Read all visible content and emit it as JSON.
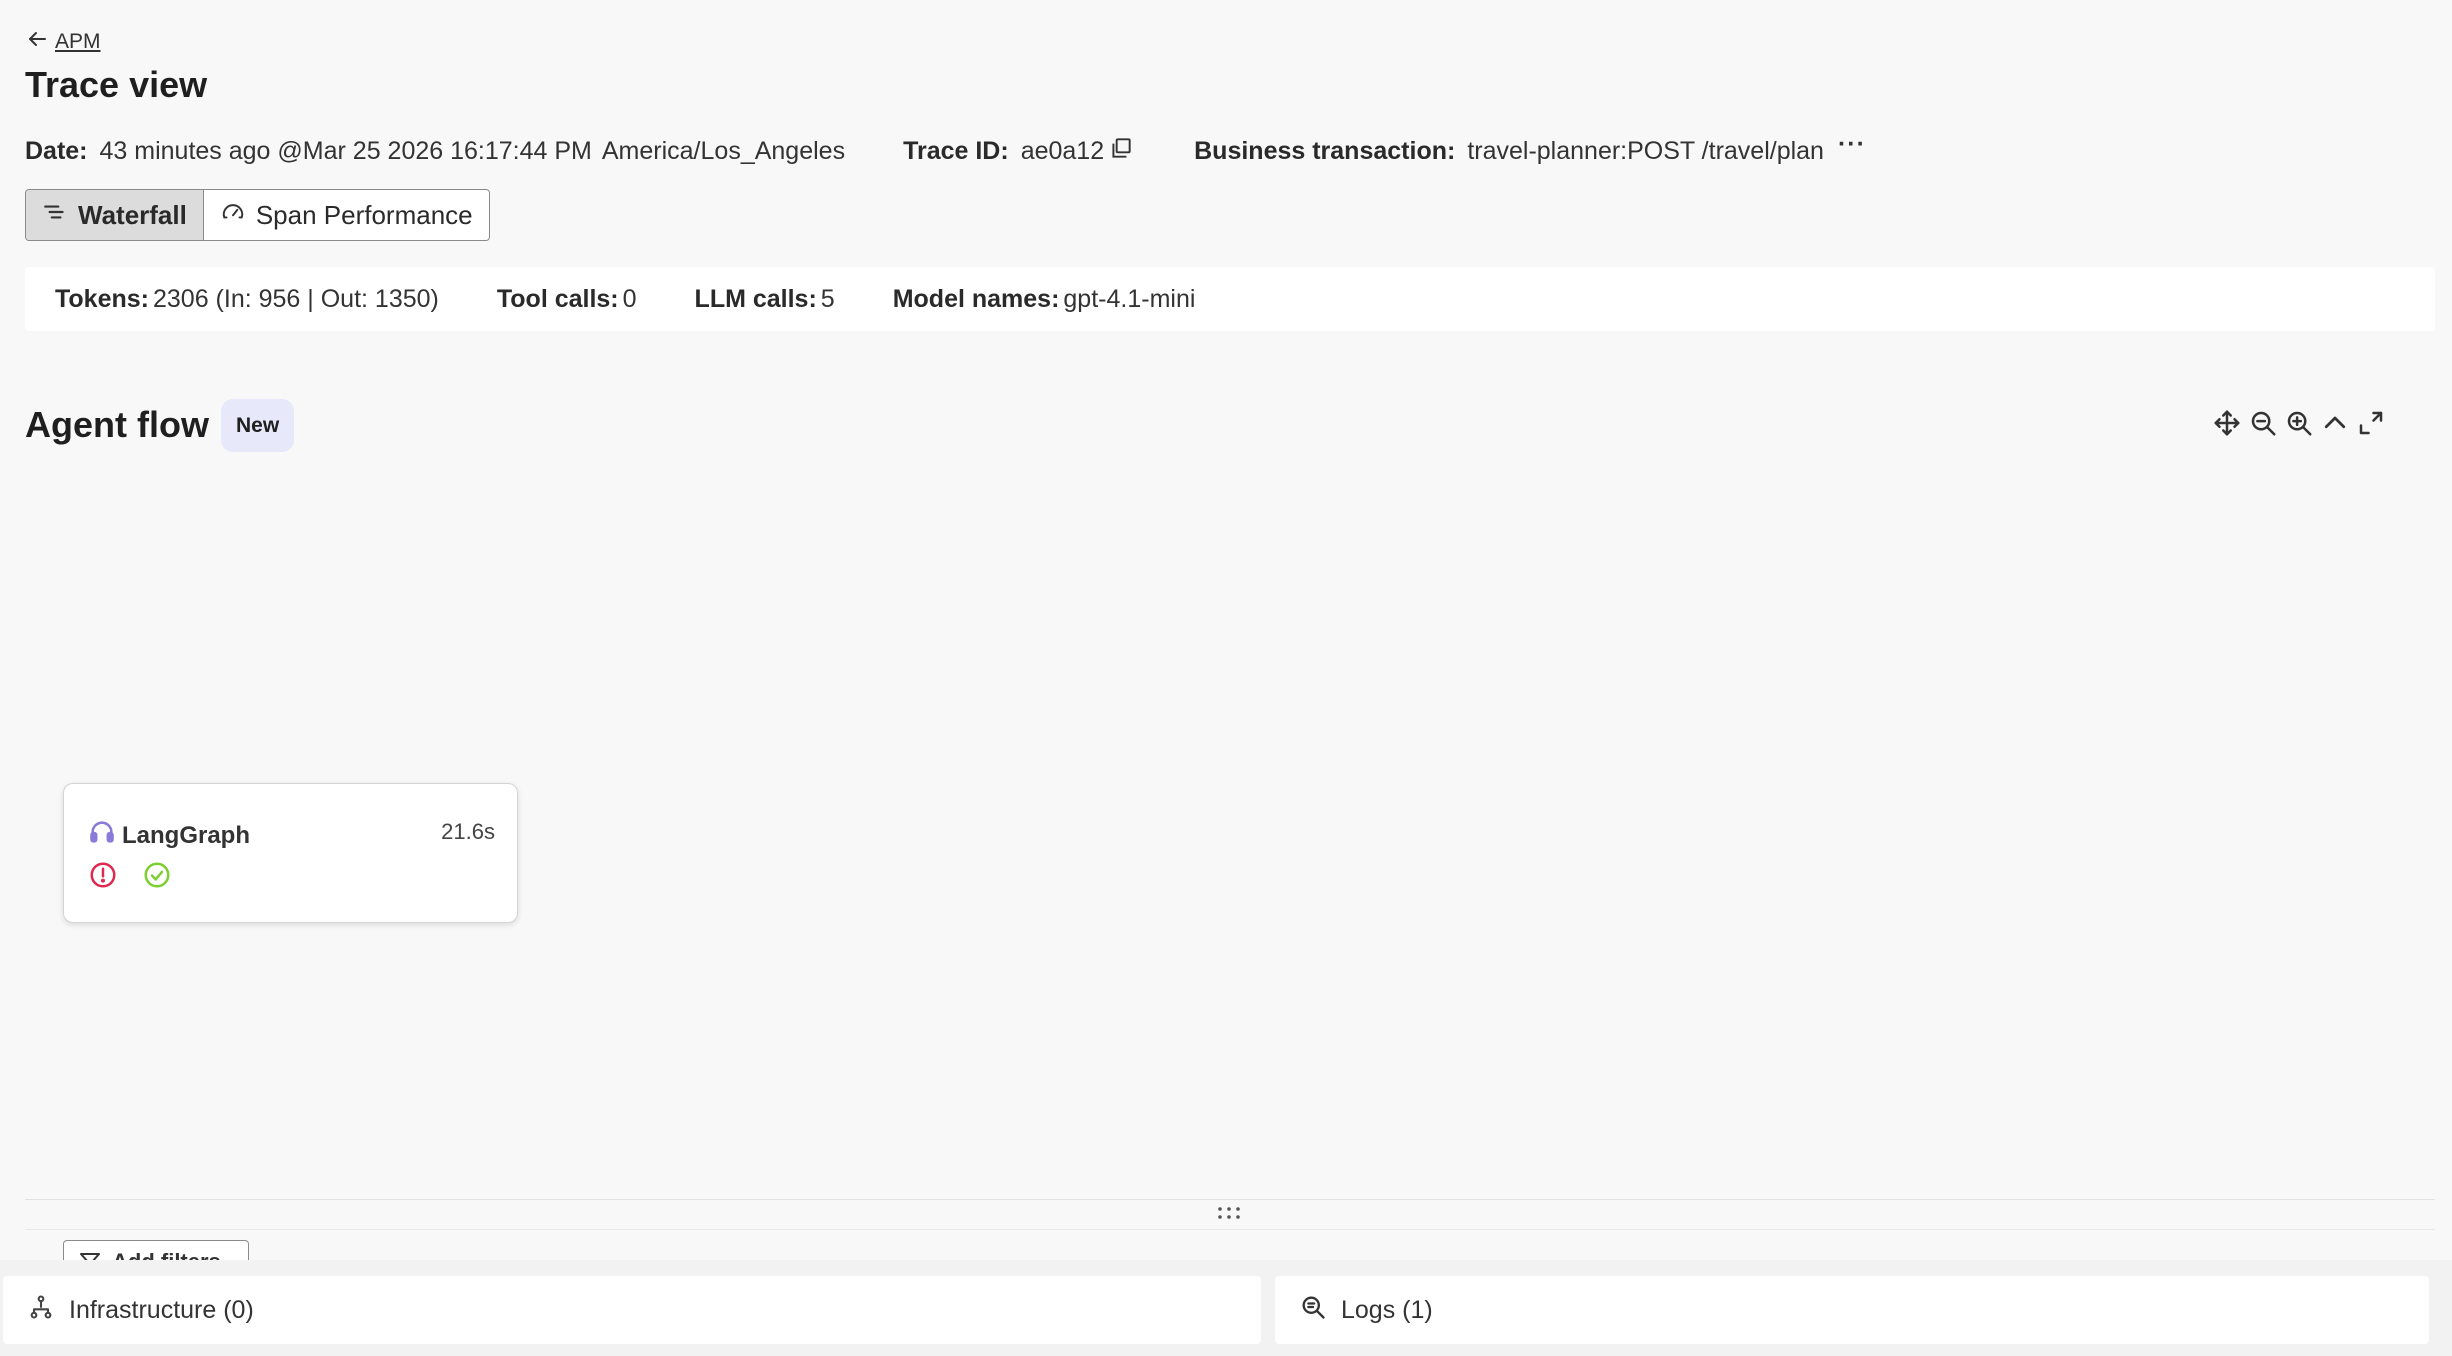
{
  "breadcrumb": {
    "label": "APM"
  },
  "page": {
    "title": "Trace view"
  },
  "meta": {
    "date_label": "Date:",
    "date_value": "43 minutes ago @Mar 25 2026 16:17:44 PM",
    "timezone": "America/Los_Angeles",
    "trace_label": "Trace ID:",
    "trace_value": "ae0a12",
    "bt_label": "Business transaction:",
    "bt_value": "travel-planner:POST /travel/plan",
    "more": "···"
  },
  "view_toggle": {
    "options": [
      {
        "label": "Waterfall",
        "icon": "waterfall-icon",
        "active": true
      },
      {
        "label": "Span Performance",
        "icon": "gauge-icon",
        "active": false
      }
    ]
  },
  "stats": {
    "tokens_label": "Tokens:",
    "tokens_value": "2306 (In: 956 | Out: 1350)",
    "tool_calls_label": "Tool calls:",
    "tool_calls_value": "0",
    "llm_calls_label": "LLM calls:",
    "llm_calls_value": "5",
    "model_names_label": "Model names:",
    "model_names_value": "gpt-4.1-mini"
  },
  "agent_flow": {
    "title": "Agent flow",
    "badge": "New",
    "toolbar": [
      "move-icon",
      "zoom-out-icon",
      "zoom-in-icon",
      "collapse-icon",
      "expand-icon"
    ],
    "node": {
      "name": "LangGraph",
      "duration": "21.6s",
      "icon": "headset-icon",
      "statuses": [
        "error",
        "success"
      ]
    }
  },
  "filters": {
    "add_label": "Add filters"
  },
  "bottom_panels": {
    "infrastructure": "Infrastructure (0)",
    "logs": "Logs (1)"
  },
  "colors": {
    "error": "#e0284f",
    "success": "#7ccf2e",
    "accent_icon": "#8b7bd8",
    "badge_bg": "#e8e8fb"
  }
}
